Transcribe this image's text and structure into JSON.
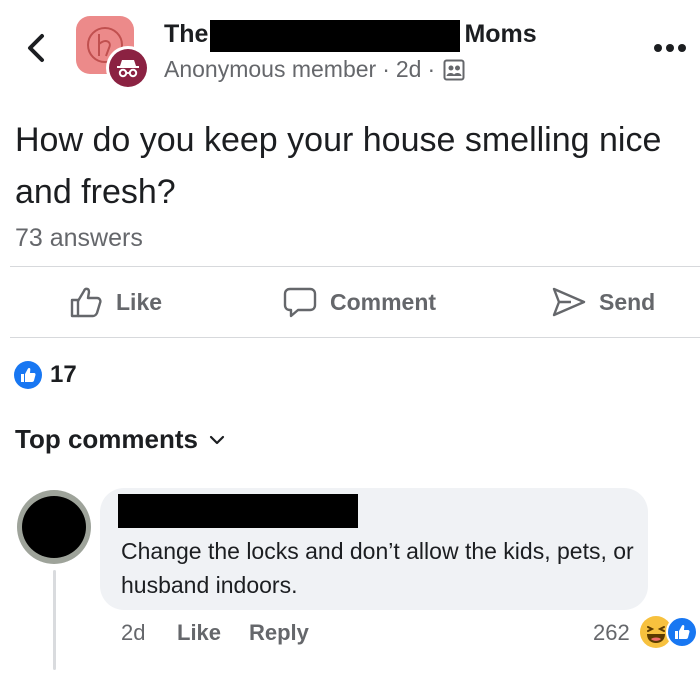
{
  "header": {
    "group_name_start": "The",
    "group_name_end": "Moms",
    "author": "Anonymous member",
    "separator": "·",
    "time": "2d",
    "separator2": "·",
    "icons": {
      "back": "chevron-left-icon",
      "more": "more-horizontal-icon",
      "privacy": "group-members-icon",
      "anonymous": "incognito-icon"
    }
  },
  "post": {
    "text": "How do you keep your house smelling nice and fresh?",
    "answers": "73 answers"
  },
  "actions": {
    "like": "Like",
    "comment": "Comment",
    "send": "Send"
  },
  "reactions": {
    "count": "17"
  },
  "comments_section": {
    "title": "Top comments"
  },
  "comment": {
    "text": "Change the locks and don’t allow the kids, pets, or husband indoors.",
    "time": "2d",
    "like": "Like",
    "reply": "Reply",
    "reaction_count": "262"
  },
  "colors": {
    "facebook_blue": "#1877f2",
    "secondary_text": "#65676b",
    "bubble_bg": "#f0f2f5",
    "anon_badge": "#8b2242",
    "group_avatar": "#ec8a8a"
  }
}
